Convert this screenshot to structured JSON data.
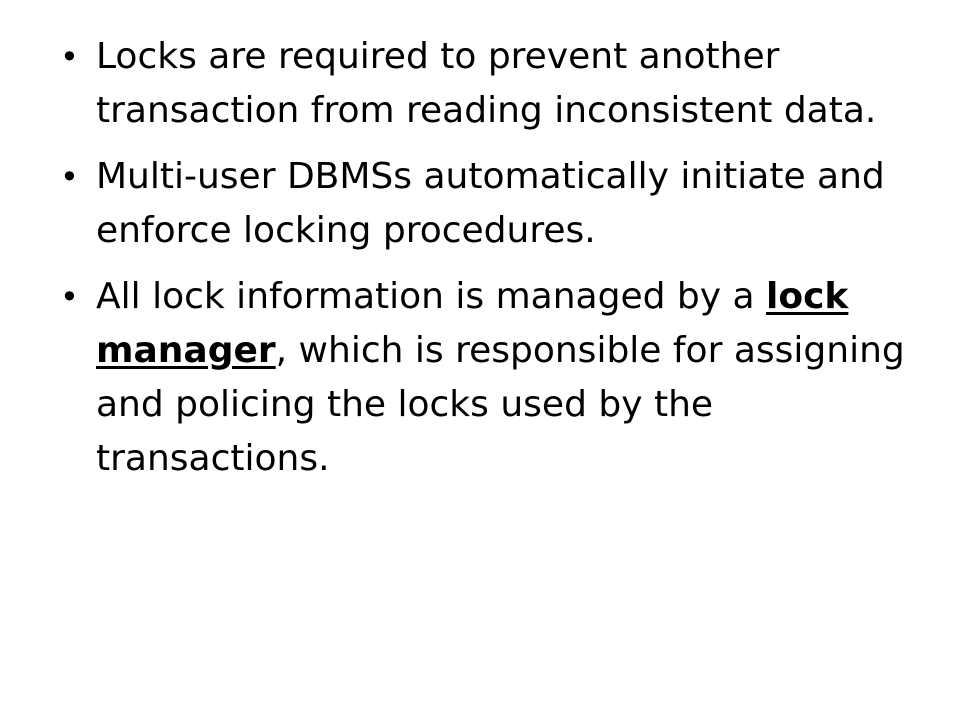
{
  "slide": {
    "bullet_symbol": "•",
    "bullets": [
      {
        "text": "Locks are required to prevent another transaction from reading inconsistent data."
      },
      {
        "text": "Multi-user DBMSs automatically initiate and enforce locking procedures."
      },
      {
        "before": "All lock information is managed by a ",
        "emphasis": "lock manager",
        "after": ", which is responsible for assigning and policing the locks used by the transactions."
      }
    ]
  }
}
